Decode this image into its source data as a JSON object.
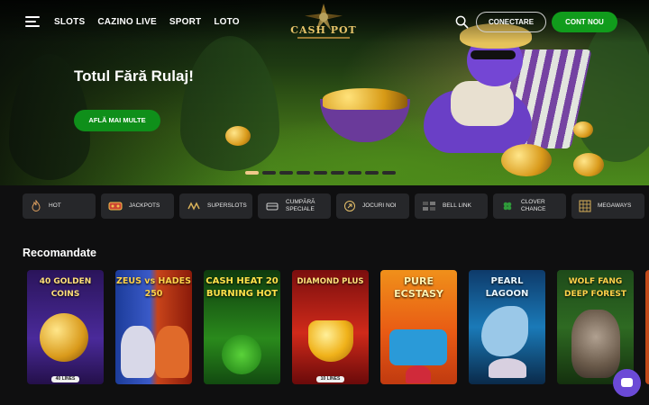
{
  "header": {
    "nav": [
      "SLOTS",
      "CAZINO LIVE",
      "SPORT",
      "LOTO"
    ],
    "logo_text": "CASH POT",
    "login_label": "CONECTARE",
    "signup_label": "CONT NOU"
  },
  "hero": {
    "title": "Totul Fără Rulaj!",
    "cta_label": "AFLĂ MAI MULTE",
    "slide_count": 9,
    "active_slide": 1
  },
  "categories": [
    {
      "label": "HOT",
      "icon": "flame-icon"
    },
    {
      "label": "JACKPOTS",
      "icon": "jackpot-icon"
    },
    {
      "label": "SUPERSLOTS",
      "icon": "superslots-icon"
    },
    {
      "label": "CUMPĂRĂ SPECIALE",
      "icon": "buy-feature-icon"
    },
    {
      "label": "JOCURI NOI",
      "icon": "new-games-icon"
    },
    {
      "label": "BELL LINK",
      "icon": "bell-link-icon"
    },
    {
      "label": "CLOVER CHANCE",
      "icon": "clover-icon"
    },
    {
      "label": "MEGAWAYS",
      "icon": "megaways-icon"
    }
  ],
  "recommended": {
    "title": "Recomandate",
    "games": [
      {
        "name": "40 GOLDEN COINS",
        "badge": "40 LINES",
        "bg": "#3b1f7a"
      },
      {
        "name": "ZEUS vs HADES 250",
        "badge": "",
        "bg": "#1a3a8a"
      },
      {
        "name": "CASH HEAT 20 BURNING HOT",
        "badge": "",
        "bg": "#1c6a1c"
      },
      {
        "name": "DIAMOND PLUS",
        "badge": "10 LINES",
        "bg": "#b0201a"
      },
      {
        "name": "PURE ECSTASY",
        "badge": "",
        "bg": "#d9741a"
      },
      {
        "name": "PEARL LAGOON",
        "badge": "",
        "bg": "#1a6aa0"
      },
      {
        "name": "WOLF FANG DEEP FOREST",
        "badge": "",
        "bg": "#1e4a1a"
      }
    ]
  },
  "colors": {
    "accent_green": "#119c1c",
    "chat": "#6b4ad6",
    "slide_active": "#f0c98a"
  }
}
